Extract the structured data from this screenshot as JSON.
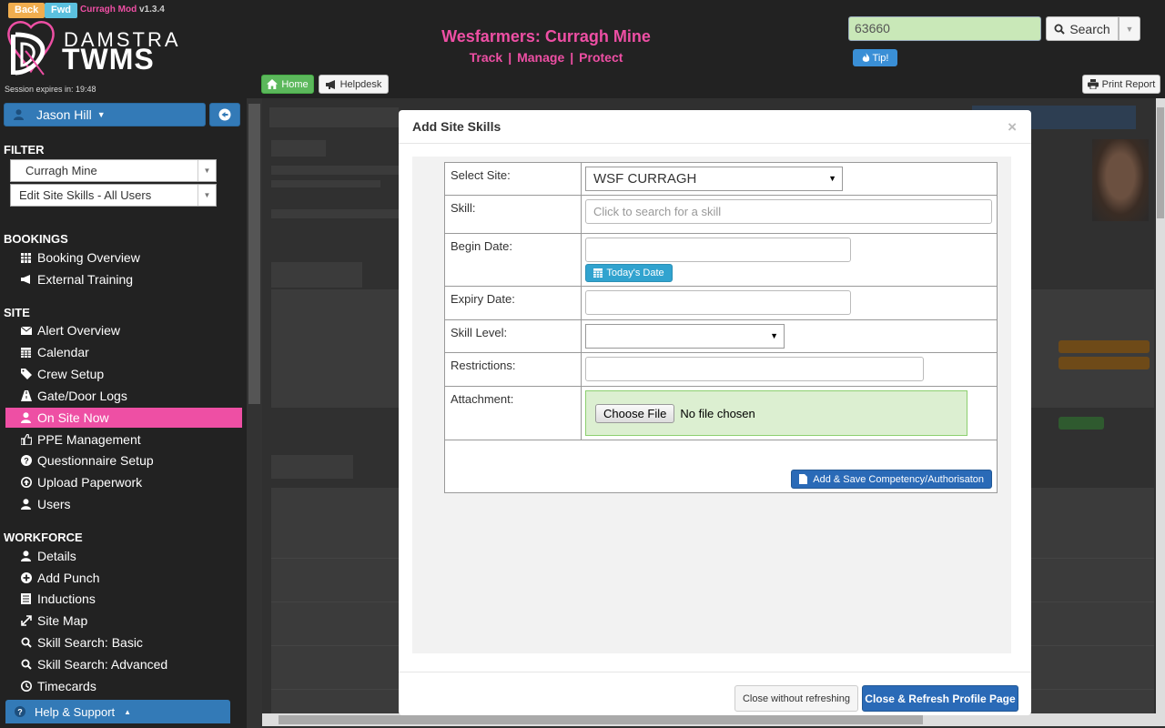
{
  "header": {
    "back_label": "Back",
    "fwd_label": "Fwd",
    "mod_name": "Curragh Mod",
    "mod_version": "v1.3.4",
    "logo_line1": "DAMSTRA",
    "logo_line2": "TWMS",
    "session_text": "Session expires in: 19:48",
    "site_title": "Wesfarmers: Curragh Mine",
    "nav_track": "Track",
    "nav_manage": "Manage",
    "nav_protect": "Protect",
    "nav_separator": "|",
    "search_value": "63660",
    "search_label": "Search",
    "tip_label": "Tip!",
    "home_label": "Home",
    "helpdesk_label": "Helpdesk",
    "print_label": "Print Report"
  },
  "sidebar": {
    "user_name": "Jason Hill",
    "filter_title": "FILTER",
    "filter_site": "Curragh Mine",
    "filter_view": "Edit Site Skills - All Users",
    "bookings_title": "BOOKINGS",
    "bookings": [
      "Booking Overview",
      "External Training"
    ],
    "site_title": "SITE",
    "site": [
      "Alert Overview",
      "Calendar",
      "Crew Setup",
      "Gate/Door Logs",
      "On Site Now",
      "PPE Management",
      "Questionnaire Setup",
      "Upload Paperwork",
      "Users"
    ],
    "workforce_title": "WORKFORCE",
    "workforce": [
      "Details",
      "Add Punch",
      "Inductions",
      "Site Map",
      "Skill Search: Basic",
      "Skill Search: Advanced",
      "Timecards"
    ],
    "help_label": "Help & Support"
  },
  "modal": {
    "title": "Add Site Skills",
    "close_glyph": "×",
    "labels": {
      "site": "Select Site:",
      "skill": "Skill:",
      "begin": "Begin Date:",
      "expiry": "Expiry Date:",
      "level": "Skill Level:",
      "restrictions": "Restrictions:",
      "attachment": "Attachment:"
    },
    "site_value": "WSF CURRAGH",
    "skill_placeholder": "Click to search for a skill",
    "today_label": "Today's Date",
    "choose_file_label": "Choose File",
    "no_file_text": "No file chosen",
    "save_label": "Add & Save Competency/Authorisaton",
    "close_norefresh_label": "Close without refreshing",
    "close_refresh_label": "Close & Refresh Profile Page"
  },
  "colors": {
    "accent_pink": "#ee4fa4",
    "primary_blue": "#337ab7",
    "success_green": "#5cb85c"
  }
}
